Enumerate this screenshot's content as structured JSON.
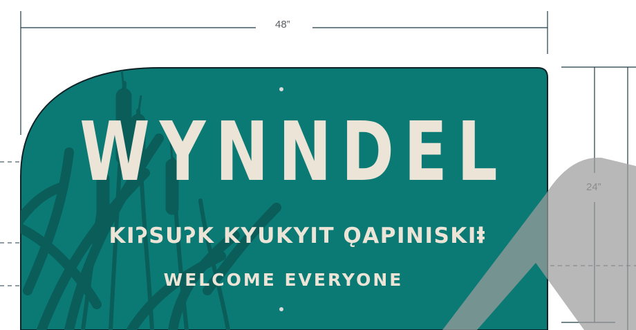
{
  "dimensions": {
    "width_label": "48”",
    "height_label": "24”"
  },
  "sign": {
    "title": "WYNNDEL",
    "subtitle": "KIʔSUʔK KYUKYIT ǪAPINISKIⱡ",
    "welcome": "WELCOME EVERYONE"
  },
  "colors": {
    "sign_teal": "#0b7a75",
    "cattail_dark": "#0a5d59",
    "lettering": "#ece4d6",
    "dimension_line": "#1f3b44",
    "shadow_gray": "#9c9c9c"
  }
}
